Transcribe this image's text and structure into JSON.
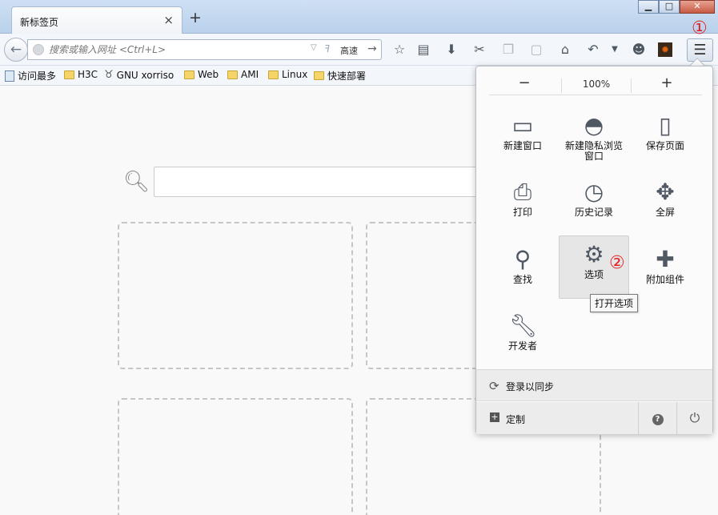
{
  "tab": {
    "title": "新标签页",
    "close": "×",
    "new_tab": "+"
  },
  "window_buttons": {
    "minimize": "▁",
    "maximize": "□",
    "close": "✕"
  },
  "navbar": {
    "back": "←",
    "url_placeholder": "搜索或输入网址 <Ctrl+L>",
    "speed_label": "高速",
    "go": "→"
  },
  "annotations": {
    "one": "①",
    "two": "②"
  },
  "bookmarks": [
    {
      "label": "访问最多",
      "icon": "file-icon"
    },
    {
      "label": "H3C",
      "icon": "folder-icon"
    },
    {
      "label": "GNU xorriso",
      "icon": "gnu-icon"
    },
    {
      "label": "Web",
      "icon": "folder-icon"
    },
    {
      "label": "AMI",
      "icon": "folder-icon"
    },
    {
      "label": "Linux",
      "icon": "folder-icon"
    },
    {
      "label": "快速部署",
      "icon": "folder-icon"
    }
  ],
  "menu": {
    "zoom": {
      "minus": "−",
      "value": "100%",
      "plus": "+"
    },
    "items": [
      {
        "label": "新建窗口",
        "icon": "new-window-icon"
      },
      {
        "label": "新建隐私浏览窗口",
        "icon": "private-mask-icon"
      },
      {
        "label": "保存页面",
        "icon": "save-page-icon"
      },
      {
        "label": "打印",
        "icon": "printer-icon"
      },
      {
        "label": "历史记录",
        "icon": "history-clock-icon"
      },
      {
        "label": "全屏",
        "icon": "fullscreen-icon"
      },
      {
        "label": "查找",
        "icon": "magnifier-icon"
      },
      {
        "label": "选项",
        "icon": "gear-icon"
      },
      {
        "label": "附加组件",
        "icon": "puzzle-icon"
      },
      {
        "label": "开发者",
        "icon": "wrench-icon"
      }
    ],
    "tooltip": "打开选项",
    "sync_label": "登录以同步",
    "customize_label": "定制"
  }
}
